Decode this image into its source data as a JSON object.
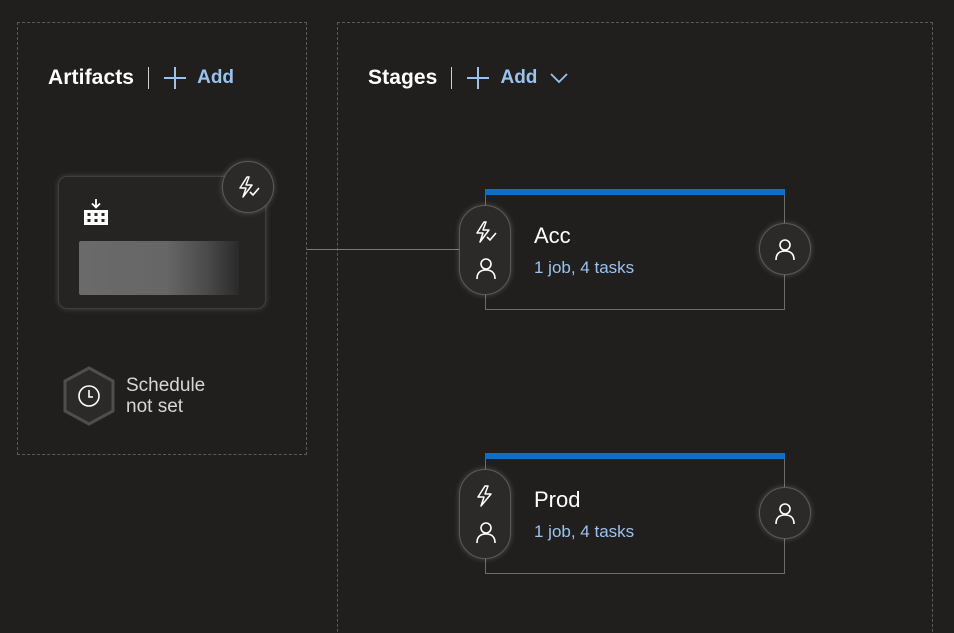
{
  "artifacts": {
    "title": "Artifacts",
    "add_label": "Add",
    "card": {
      "name": "",
      "icon": "build-artifact-icon",
      "trigger_icon": "continuous-deployment-trigger-icon"
    },
    "schedule": {
      "line1": "Schedule",
      "line2": "not set",
      "icon": "clock-icon"
    }
  },
  "stages": {
    "title": "Stages",
    "add_label": "Add",
    "items": [
      {
        "name": "Acc",
        "tasks": "1 job, 4 tasks",
        "trigger_icon": "trigger-check-icon",
        "pre_approver_icon": "person-icon",
        "post_approver_icon": "person-icon"
      },
      {
        "name": "Prod",
        "tasks": "1 job, 4 tasks",
        "trigger_icon": "trigger-icon",
        "pre_approver_icon": "person-icon",
        "post_approver_icon": "person-icon"
      }
    ]
  },
  "colors": {
    "background": "#201f1e",
    "accent_link": "#9ac2ee",
    "stage_bar": "#0f6fc6",
    "card_border": "#5a5a5a"
  }
}
